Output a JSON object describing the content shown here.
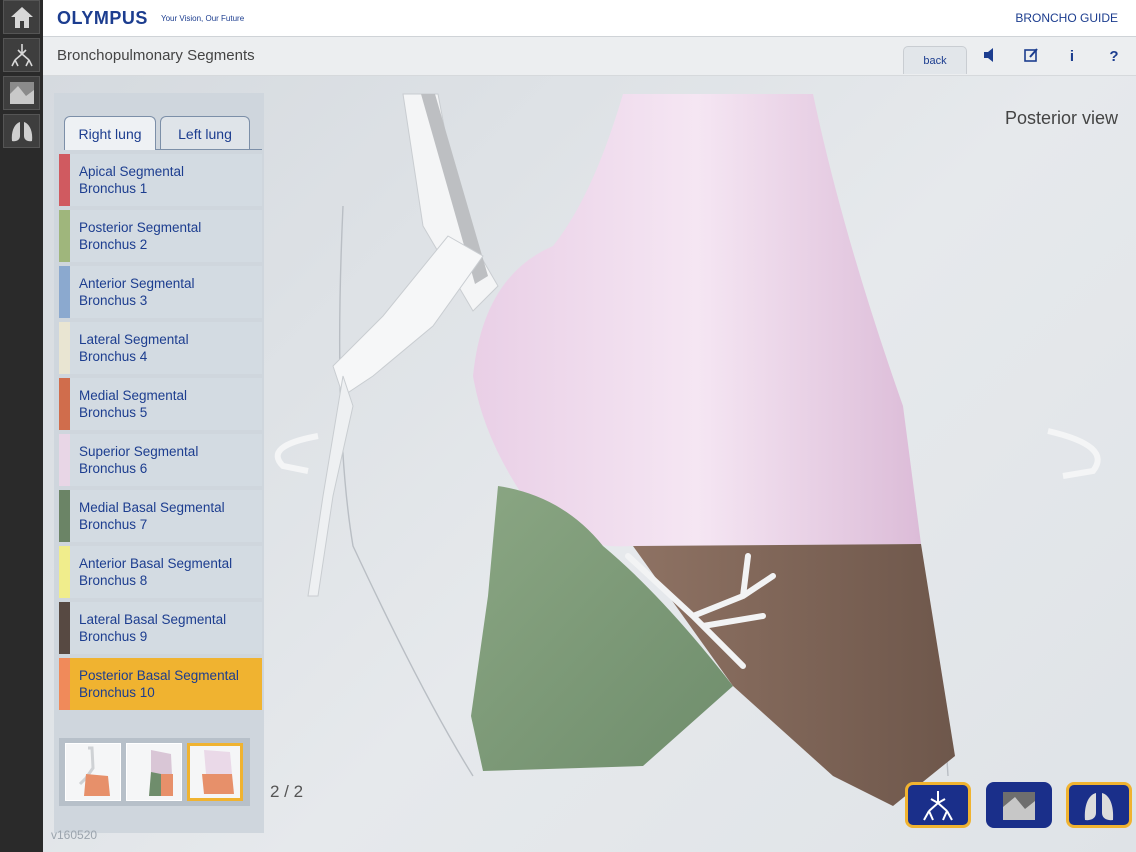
{
  "header": {
    "brand": "OLYMPUS",
    "tagline": "Your Vision, Our Future",
    "app_name": "BRONCHO GUIDE"
  },
  "titlebar": {
    "title": "Bronchopulmonary Segments",
    "back_label": "back",
    "icons": [
      "speaker-icon",
      "edit-icon",
      "info-icon",
      "help-icon"
    ],
    "info_glyph": "i",
    "help_glyph": "?"
  },
  "rail": {
    "items": [
      "home-icon",
      "bronchial-tree-icon",
      "image-icon",
      "lungs-icon"
    ]
  },
  "panel": {
    "tabs": [
      {
        "label": "Right lung",
        "selected": true
      },
      {
        "label": "Left lung",
        "selected": false
      }
    ],
    "segments": [
      {
        "label": "Apical Segmental\nBronchus 1",
        "color": "#d05a60"
      },
      {
        "label": "Posterior Segmental\nBronchus 2",
        "color": "#9fb67c"
      },
      {
        "label": "Anterior Segmental\nBronchus 3",
        "color": "#8ba9cf"
      },
      {
        "label": "Lateral Segmental\nBronchus 4",
        "color": "#e9e5d2"
      },
      {
        "label": "Medial Segmental\nBronchus 5",
        "color": "#d06d4c"
      },
      {
        "label": "Superior Segmental\nBronchus 6",
        "color": "#e8d6e6"
      },
      {
        "label": "Medial Basal Segmental\nBronchus 7",
        "color": "#6b8466"
      },
      {
        "label": "Anterior Basal Segmental\nBronchus 8",
        "color": "#f0ed8c"
      },
      {
        "label": "Lateral Basal Segmental\nBronchus 9",
        "color": "#574942"
      },
      {
        "label": "Posterior Basal Segmental\nBronchus 10",
        "color": "#f08a5a",
        "active": true
      }
    ],
    "version": "v160520"
  },
  "viewer": {
    "view_label": "Posterior view",
    "page_count": "2 / 2"
  },
  "bottom_nav": [
    {
      "icon": "bronchial-tree-icon",
      "selected": true
    },
    {
      "icon": "image-icon",
      "selected": false
    },
    {
      "icon": "lungs-icon",
      "selected": true
    }
  ],
  "colors": {
    "brand": "#1c3d8f",
    "accent": "#f0b330",
    "nav_button": "#1a2f8a"
  }
}
